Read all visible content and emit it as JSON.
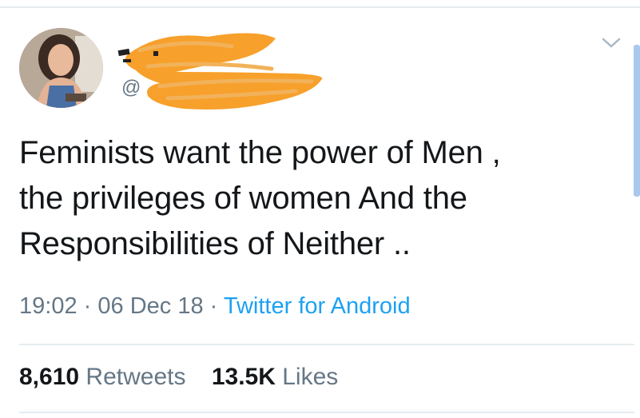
{
  "tweet": {
    "handle": "@",
    "text_lines": [
      "Feminists want the power of Men ,",
      "the privileges of women And the",
      "Responsibilities of Neither .."
    ],
    "time": "19:02",
    "date": "06 Dec 18",
    "source": "Twitter for Android",
    "separator": "·",
    "retweets": {
      "count": "8,610",
      "label": "Retweets"
    },
    "likes": {
      "count": "13.5K",
      "label": "Likes"
    }
  },
  "icons": {
    "menu": "chevron-down-icon",
    "avatar": "profile-photo"
  },
  "colors": {
    "text": "#14171a",
    "secondary": "#657786",
    "link": "#1da1f2",
    "redaction": "#f7a02b",
    "divider": "#e6ecf0"
  }
}
